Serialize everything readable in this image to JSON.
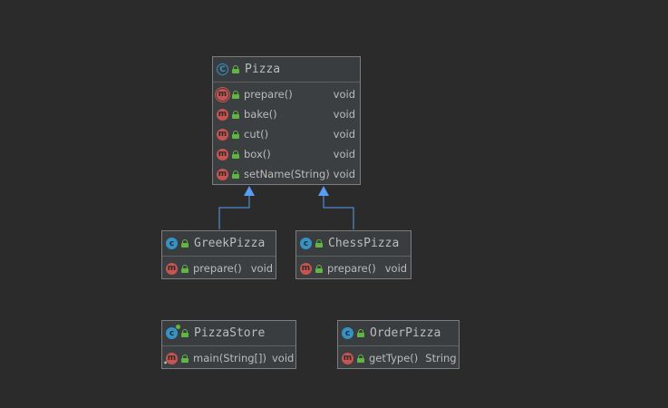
{
  "colors": {
    "background": "#2b2b2b",
    "box": "#3c3f41",
    "edge": "#589df6",
    "class_icon": "#3592c4",
    "method_icon": "#c75450",
    "public_lock": "#62b543"
  },
  "classes": {
    "pizza": {
      "name": "Pizza",
      "icon": "abstract-class-icon",
      "methods": [
        {
          "signature": "prepare()",
          "returns": "void",
          "icon": "abstract-method-icon"
        },
        {
          "signature": "bake()",
          "returns": "void",
          "icon": "method-icon"
        },
        {
          "signature": "cut()",
          "returns": "void",
          "icon": "method-icon"
        },
        {
          "signature": "box()",
          "returns": "void",
          "icon": "method-icon"
        },
        {
          "signature": "setName(String)",
          "returns": "void",
          "icon": "method-icon"
        }
      ]
    },
    "greek_pizza": {
      "name": "GreekPizza",
      "icon": "class-icon",
      "methods": [
        {
          "signature": "prepare()",
          "returns": "void",
          "icon": "method-icon"
        }
      ]
    },
    "chess_pizza": {
      "name": "ChessPizza",
      "icon": "class-icon",
      "methods": [
        {
          "signature": "prepare()",
          "returns": "void",
          "icon": "method-icon"
        }
      ]
    },
    "pizza_store": {
      "name": "PizzaStore",
      "icon": "runnable-class-icon",
      "methods": [
        {
          "signature": "main(String[])",
          "returns": "void",
          "icon": "static-method-icon"
        }
      ]
    },
    "order_pizza": {
      "name": "OrderPizza",
      "icon": "class-icon",
      "methods": [
        {
          "signature": "getType()",
          "returns": "String",
          "icon": "method-icon"
        }
      ]
    }
  },
  "relations": [
    {
      "from": "GreekPizza",
      "to": "Pizza",
      "type": "extends"
    },
    {
      "from": "ChessPizza",
      "to": "Pizza",
      "type": "extends"
    }
  ]
}
